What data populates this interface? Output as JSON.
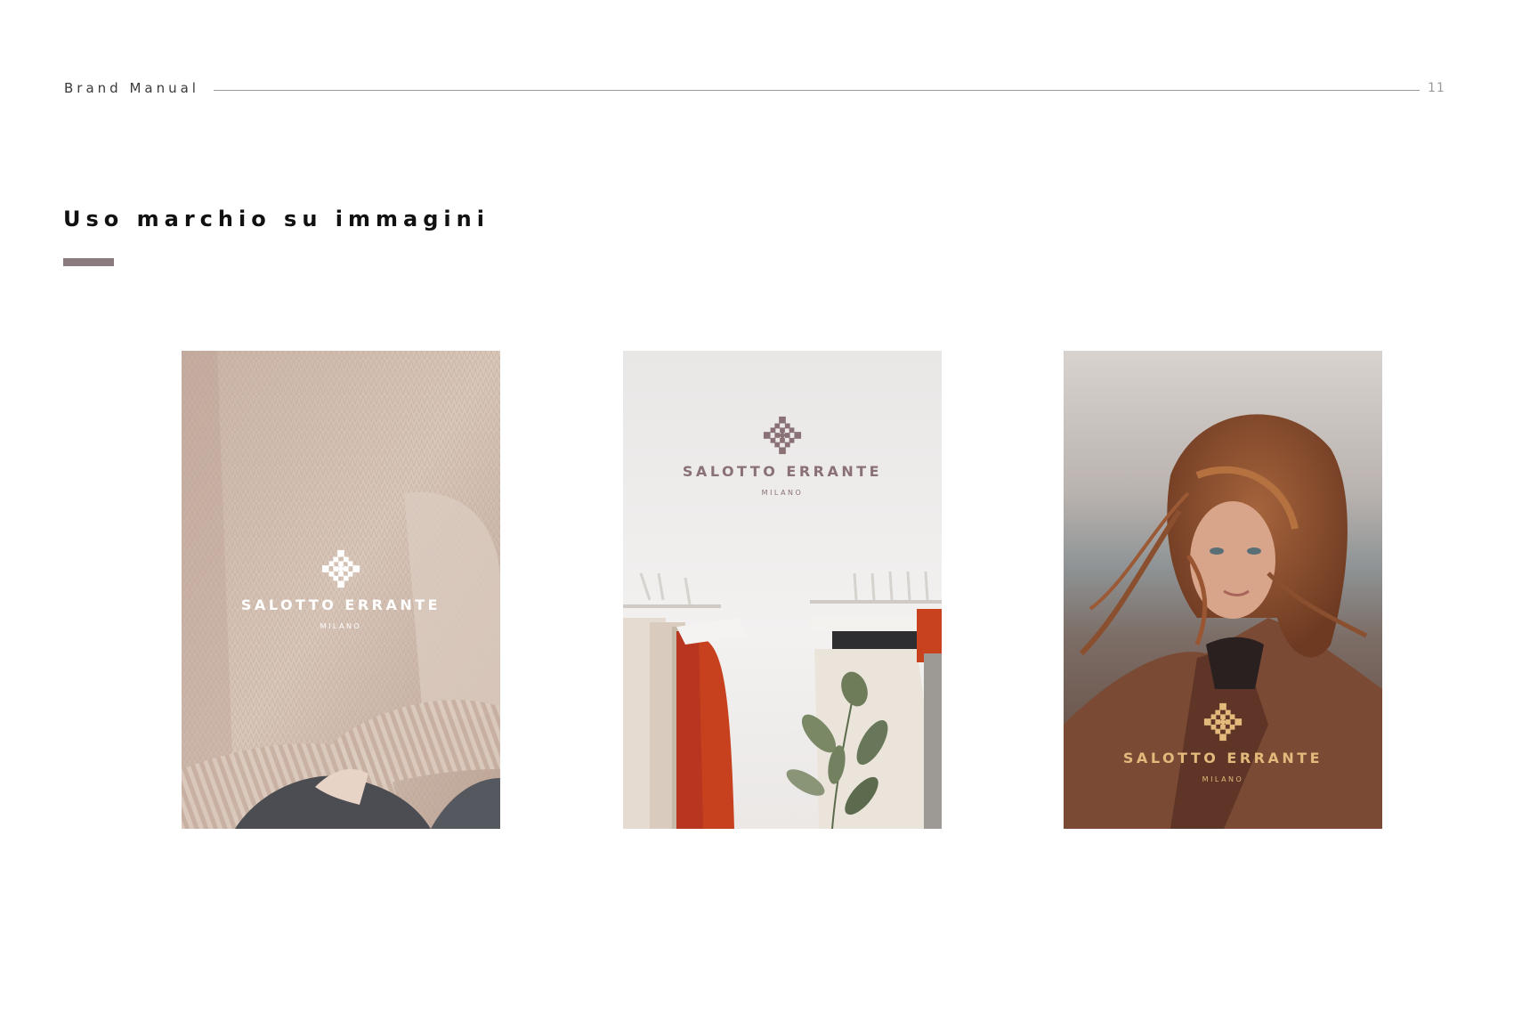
{
  "header": {
    "doc_title": "Brand Manual",
    "page_number": "11"
  },
  "section": {
    "title": "Uso marchio su immagini",
    "accent_color": "#8a7b7f"
  },
  "brand": {
    "name": "SALOTTO ERRANTE",
    "city": "MILANO"
  },
  "images": [
    {
      "subject": "knit sweater close-up",
      "logo_color": "#ffffff"
    },
    {
      "subject": "clothing rack with plant",
      "logo_color": "#8a7176"
    },
    {
      "subject": "woman with windswept hair in camel coat",
      "logo_color": "#e3b97c"
    }
  ]
}
